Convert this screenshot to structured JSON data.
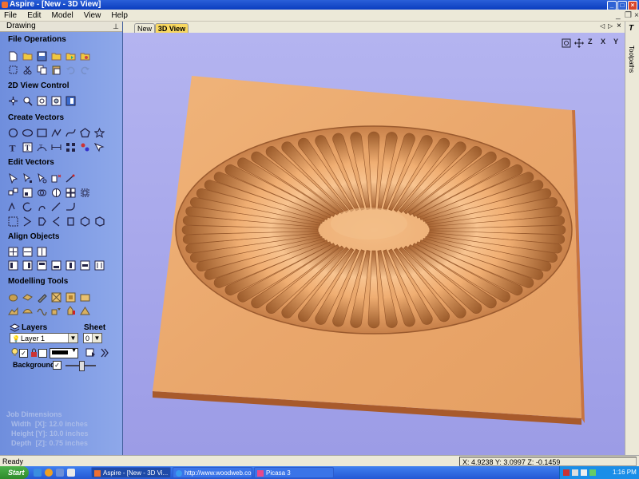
{
  "window": {
    "title": "Aspire - [New - 3D View]",
    "min": "_",
    "max": "□",
    "close": "×"
  },
  "menu": {
    "items": [
      "File",
      "Edit",
      "Model",
      "View",
      "Help"
    ]
  },
  "mdi_controls": {
    "min": "_",
    "restore": "❐",
    "close": "×"
  },
  "panel": {
    "title": "Drawing",
    "pin": "⊥",
    "sections": {
      "file_operations": "File Operations",
      "view_control": "2D View Control",
      "create_vectors": "Create Vectors",
      "edit_vectors": "Edit Vectors",
      "align_objects": "Align Objects",
      "modelling_tools": "Modelling Tools"
    },
    "layers_label": "Layers",
    "sheet_label": "Sheet",
    "layer_value": "Layer 1",
    "sheet_value": "0",
    "background_label": "Background",
    "background_checked": "✓",
    "job": {
      "heading": "Job Dimensions",
      "width": "Width  [X]: 12.0 inches",
      "height": "Height [Y]: 10.0 inches",
      "depth": "Depth  [Z]: 0.75 inches"
    }
  },
  "tabs": {
    "items": [
      "New",
      "3D View"
    ],
    "active": "3D View"
  },
  "view_nav": {
    "prev": "◁",
    "next": "▷",
    "close": "×"
  },
  "view_icons": [
    "zoom-extents",
    "pan-3d",
    "z-axis-view",
    "x-axis-view",
    "y-axis-view"
  ],
  "view_icon_labels": {
    "z": "Z",
    "x": "X",
    "y": "Y"
  },
  "right_strip": {
    "label": "Toolpaths",
    "icon": "T"
  },
  "status": {
    "left": "Ready",
    "coords": "X: 4.9238 Y: 3.0997 Z: -0.1459"
  },
  "taskbar": {
    "start": "Start",
    "buttons": [
      "Aspire - [New - 3D Vi...",
      "http://www.woodweb.co...",
      "Picasa 3"
    ],
    "clock": "1:16 PM"
  },
  "colors": {
    "wood": "#e9a46a",
    "view_bg": "#a8a8ec",
    "panel": "#7f9be3",
    "title": "#0a3dbf"
  }
}
